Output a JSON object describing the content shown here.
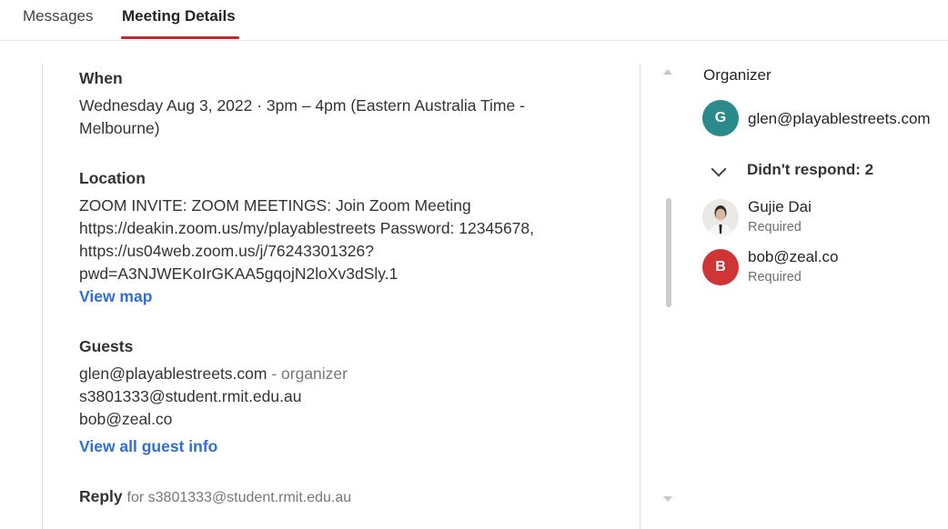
{
  "tabs": {
    "messages": "Messages",
    "meeting_details": "Meeting Details"
  },
  "accent_color": "#c4262e",
  "details": {
    "when": {
      "label": "When",
      "line1": "Wednesday Aug 3, 2022 · 3pm – 4pm (Eastern Australia Time -",
      "line2": "Melbourne)"
    },
    "location": {
      "label": "Location",
      "lines": [
        "ZOOM INVITE: ZOOM MEETINGS: Join Zoom Meeting",
        "https://deakin.zoom.us/my/playablestreets Password: 12345678,",
        "https://us04web.zoom.us/j/76243301326?",
        "pwd=A3NJWEKoIrGKAA5gqojN2loXv3dSly.1"
      ],
      "view_map": "View map"
    },
    "guests": {
      "label": "Guests",
      "list": [
        {
          "email": "glen@playablestreets.com",
          "suffix": " - organizer"
        },
        {
          "email": "s3801333@student.rmit.edu.au",
          "suffix": ""
        },
        {
          "email": "bob@zeal.co",
          "suffix": ""
        }
      ],
      "view_all": "View all guest info"
    },
    "reply": {
      "label": "Reply",
      "for_text": "for s3801333@student.rmit.edu.au"
    }
  },
  "sidebar": {
    "organizer_label": "Organizer",
    "organizer": {
      "initial": "G",
      "email": "glen@playablestreets.com",
      "color": "#2b8a8a"
    },
    "response_group": "Didn't respond: 2",
    "people": [
      {
        "name": "Gujie Dai",
        "role": "Required",
        "avatar": "photo"
      },
      {
        "name": "bob@zeal.co",
        "role": "Required",
        "initial": "B",
        "color": "#cf3535"
      }
    ]
  }
}
